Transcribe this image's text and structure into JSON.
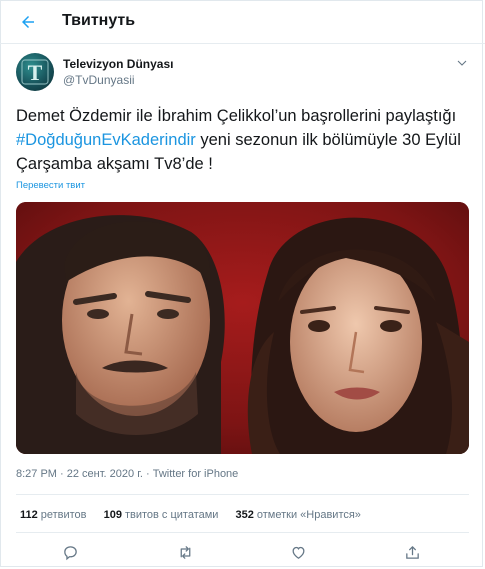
{
  "colors": {
    "accent": "#1da1f2",
    "link": "#1b95e0",
    "secondary_text": "#657786",
    "divider": "#e6ecf0",
    "photo_background": "#7a1414"
  },
  "header": {
    "back_icon": "arrow-left-icon",
    "title": "Твитнуть"
  },
  "tweet": {
    "author": {
      "avatar_letter": "T",
      "display_name": "Televizyon Dünyası",
      "handle": "@TvDunyasii"
    },
    "more_icon": "chevron-down-icon",
    "text_before": "Demet Özdemir ile İbrahim Çelikkol’un başrollerini paylaştığı ",
    "hashtag": "#DoğduğunEvKaderindir",
    "text_after": " yeni sezonun ilk bölümüyle 30 Eylül Çarşamba akşamı Tv8’de !",
    "translate_link": "Перевести твит",
    "meta": {
      "time": "8:27 PM",
      "separator": " · ",
      "date": "22 сент. 2020 г.",
      "source": "Twitter for iPhone"
    },
    "stats": [
      {
        "count": "112",
        "label": "ретвитов"
      },
      {
        "count": "109",
        "label": "твитов с цитатами"
      },
      {
        "count": "352",
        "label": "отметки «Нравится»"
      }
    ],
    "actions": {
      "reply_icon": "reply-icon",
      "retweet_icon": "retweet-icon",
      "like_icon": "heart-icon",
      "share_icon": "share-icon"
    }
  }
}
